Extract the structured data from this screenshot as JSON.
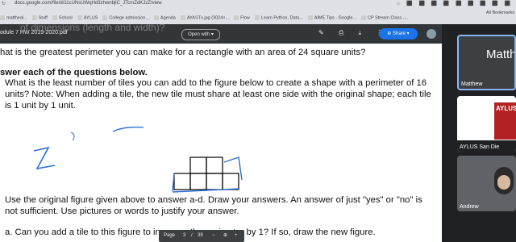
{
  "browser": {
    "url": "docs.google.com/file/d/11cUNsUWqHd3zhwnbjlC_JTcmZdKJzZ/view",
    "bookmarks": [
      "mattheal...",
      "Stuff",
      "School",
      "AYLUS",
      "College admission...",
      "Agenda",
      "AYASTx.jpg (3024×...",
      "Flow",
      "Learn Python, Data...",
      "AIME Tips - Google...",
      "CP Stream Class -..."
    ],
    "bookmarks_right": "All Bookmarks"
  },
  "viewer": {
    "filename": "odule 7 HW 2019-2020.pdf",
    "open_with": "Open with",
    "share": "Share",
    "ghost_title": "of dimensions (length and width)?"
  },
  "doc": {
    "line1": "hat is the greatest perimeter you can make for a rectangle with an area of 24 square units?",
    "heading": "swer each of the questions below.",
    "p1": "What is the least number of tiles you can add to the figure below to create a shape with a perimeter of 16",
    "p2": "units? Note: When adding a tile, the new tile must share at least one side with the original shape; each tile",
    "p3": "is 1 unit by 1 unit.",
    "p4": "Use the original figure given above to answer a-d. Draw your answers. An answer of just \"yes\" or \"no\" is",
    "p5": "not sufficient. Use pictures or words to justify your answer.",
    "p6": "a.   Can you add a tile to this figure to increase the perimeter by 1? If so, draw the new figure."
  },
  "pagebar": {
    "label": "Page",
    "current": "3",
    "sep": "/",
    "total": "39"
  },
  "meeting": {
    "p1_big": "Matthe",
    "p1_name": "Matthew",
    "p2_name": "AYLUS San Die",
    "p2_logo": "AYLUS",
    "p3_name": "Andrew"
  }
}
